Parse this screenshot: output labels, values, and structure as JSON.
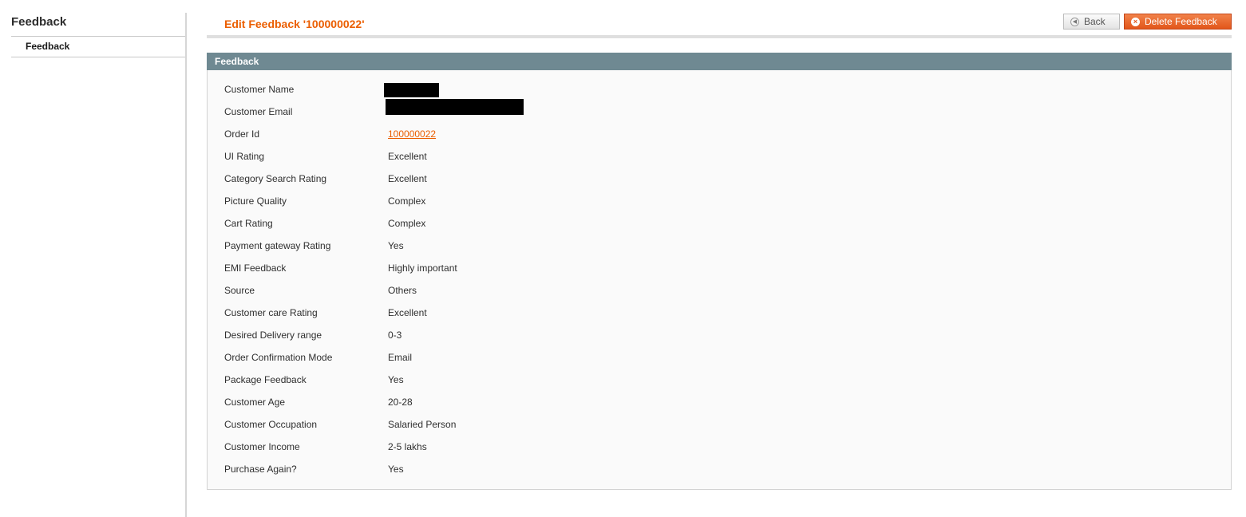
{
  "sidebar": {
    "title": "Feedback",
    "items": [
      {
        "label": "Feedback"
      }
    ]
  },
  "header": {
    "title": "Edit Feedback '100000022'",
    "buttons": {
      "back": {
        "label": "Back",
        "icon": "back-arrow-icon"
      },
      "delete": {
        "label": "Delete Feedback",
        "icon": "delete-x-icon"
      }
    }
  },
  "panel": {
    "title": "Feedback",
    "fields": [
      {
        "label": "Customer Name",
        "value": "[redacted]"
      },
      {
        "label": "Customer Email",
        "value": "[redacted]"
      },
      {
        "label": "Order Id",
        "value": "100000022"
      },
      {
        "label": "UI Rating",
        "value": "Excellent"
      },
      {
        "label": "Category Search Rating",
        "value": "Excellent"
      },
      {
        "label": "Picture Quality",
        "value": "Complex"
      },
      {
        "label": "Cart Rating",
        "value": "Complex"
      },
      {
        "label": "Payment gateway Rating",
        "value": "Yes"
      },
      {
        "label": "EMI Feedback",
        "value": "Highly important"
      },
      {
        "label": "Source",
        "value": "Others"
      },
      {
        "label": "Customer care Rating",
        "value": "Excellent"
      },
      {
        "label": "Desired Delivery range",
        "value": "0-3"
      },
      {
        "label": "Order Confirmation Mode",
        "value": "Email"
      },
      {
        "label": "Package Feedback",
        "value": "Yes"
      },
      {
        "label": "Customer Age",
        "value": "20-28"
      },
      {
        "label": "Customer Occupation",
        "value": "Salaried Person"
      },
      {
        "label": "Customer Income",
        "value": "2-5 lakhs"
      },
      {
        "label": "Purchase Again?",
        "value": "Yes"
      }
    ]
  },
  "colors": {
    "accent": "#eb5e00",
    "panel_header": "#6f8992",
    "delete_button": "#e2561a"
  }
}
